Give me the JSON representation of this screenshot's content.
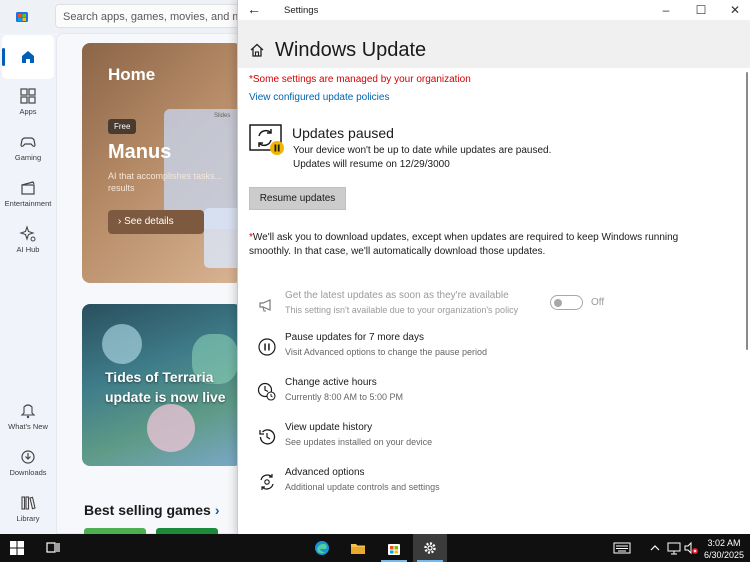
{
  "store": {
    "search_placeholder": "Search apps, games, movies, and more",
    "nav": [
      {
        "label": "",
        "icon": "home-icon"
      },
      {
        "label": "Apps",
        "icon": "apps-icon"
      },
      {
        "label": "Gaming",
        "icon": "gaming-icon"
      },
      {
        "label": "Entertainment",
        "icon": "entertainment-icon"
      },
      {
        "label": "AI Hub",
        "icon": "ai-hub-icon"
      },
      {
        "label": "What's New",
        "icon": "whats-new-icon"
      },
      {
        "label": "Downloads",
        "icon": "downloads-icon"
      },
      {
        "label": "Library",
        "icon": "library-icon"
      }
    ],
    "hero": {
      "title": "Home",
      "badge": "Free",
      "app_name": "Manus",
      "description": "AI that accomplishes tasks... results",
      "details_button": "See details",
      "mock_label": "Slides"
    },
    "game_card_title": "Tides of Terraria update is now live",
    "best_selling": "Best selling games",
    "best_selling_chevron": "›"
  },
  "settings": {
    "window_title": "Settings",
    "page_title": "Windows Update",
    "managed_note": "*Some settings are managed by your organization",
    "view_policies_link": "View configured update policies",
    "status": {
      "title": "Updates paused",
      "line1": "Your device won't be up to date while updates are paused.",
      "line2": "Updates will resume on 12/29/3000"
    },
    "resume_button": "Resume updates",
    "policy_note_star": "*",
    "policy_note": "We'll ask you to download updates, except when updates are required to keep Windows running smoothly. In that case, we'll automatically download those updates.",
    "options": [
      {
        "title": "Get the latest updates as soon as they're available",
        "subtitle": "This setting isn't available due to your organization's policy",
        "icon": "megaphone-icon",
        "toggle": "Off",
        "disabled": true
      },
      {
        "title": "Pause updates for 7 more days",
        "subtitle": "Visit Advanced options to change the pause period",
        "icon": "pause-icon"
      },
      {
        "title": "Change active hours",
        "subtitle": "Currently 8:00 AM to 5:00 PM",
        "icon": "clock-icon"
      },
      {
        "title": "View update history",
        "subtitle": "See updates installed on your device",
        "icon": "history-icon"
      },
      {
        "title": "Advanced options",
        "subtitle": "Additional update controls and settings",
        "icon": "gear-sync-icon"
      }
    ]
  },
  "taskbar": {
    "time": "3:02 AM",
    "date": "6/30/2025"
  },
  "colors": {
    "accent": "#005fb8",
    "warning_red": "#d40000",
    "link_blue": "#0063b1",
    "taskbar": "#101010"
  }
}
